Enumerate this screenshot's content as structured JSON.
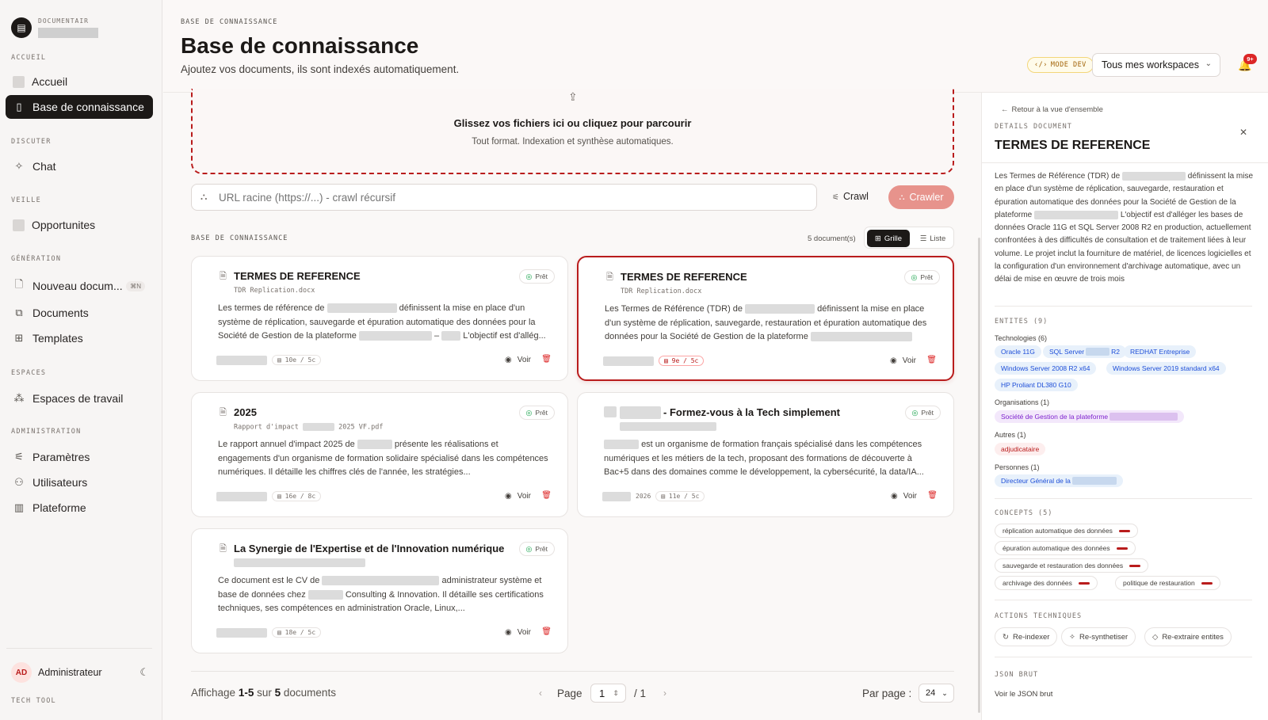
{
  "sidebar": {
    "brand_label": "DOCUMENTAIR",
    "sections": {
      "accueil": "ACCUEIL",
      "discuter": "DISCUTER",
      "veille": "VEILLE",
      "generation": "GÉNÉRATION",
      "espaces": "ESPACES",
      "administration": "ADMINISTRATION"
    },
    "items": {
      "accueil": "Accueil",
      "base": "Base de connaissance",
      "chat": "Chat",
      "opportunites": "Opportunites",
      "nouveau": "Nouveau docum...",
      "nouveau_kbd": "⌘N",
      "documents": "Documents",
      "templates": "Templates",
      "espaces_travail": "Espaces de travail",
      "parametres": "Paramètres",
      "utilisateurs": "Utilisateurs",
      "plateforme": "Plateforme"
    },
    "user": {
      "initials": "AD",
      "name": "Administrateur"
    },
    "footer": "TECH TOOL"
  },
  "header": {
    "breadcrumb": "BASE DE CONNAISSANCE",
    "title": "Base de connaissance",
    "subtitle": "Ajoutez vos documents, ils sont indexés automatiquement.",
    "mode_dev": "MODE DEV",
    "workspace": "Tous mes workspaces",
    "notif_count": "9+"
  },
  "dropzone": {
    "title": "Glissez vos fichiers ici ou cliquez pour parcourir",
    "subtitle": "Tout format. Indexation et synthèse automatiques."
  },
  "crawl": {
    "placeholder": "URL racine (https://...) - crawl récursif",
    "link_label": "Crawl",
    "button_label": "Crawler"
  },
  "list": {
    "section_label": "BASE DE CONNAISSANCE",
    "count": "5 document(s)",
    "view_grid": "Grille",
    "view_list": "Liste",
    "voir_label": "Voir",
    "status_label": "Prêt"
  },
  "cards": [
    {
      "title": "TERMES DE REFERENCE",
      "file": "TDR Replication.docx",
      "desc_a": "Les termes de référence de",
      "desc_b": "définissent la mise en place d'un système de réplication, sauvegarde et épuration automatique des données pour la Société de Gestion de la plateforme",
      "desc_c": "L'objectif est d'allég...",
      "chip": "10e / 5c",
      "year": ""
    },
    {
      "title": "TERMES DE REFERENCE",
      "file": "TDR Replication.docx",
      "desc_a": "Les Termes de Référence (TDR) de",
      "desc_b": "définissent la mise en place d'un système de réplication, sauvegarde, restauration et épuration automatique des données pour la Société de Gestion de la plateforme",
      "desc_c": "",
      "chip": "9e / 5c",
      "year": ""
    },
    {
      "title": "2025",
      "file_a": "Rapport d'impact",
      "file_b": "2025 VF.pdf",
      "desc_a": "Le rapport annuel d'impact 2025 de",
      "desc_b": "présente les réalisations et engagements d'un organisme de formation solidaire spécialisé dans les compétences numériques. Il détaille les chiffres clés de l'année, les stratégies...",
      "chip": "16e / 8c",
      "year": ""
    },
    {
      "title": "- Formez-vous à la Tech simplement",
      "desc_b": "est un organisme de formation français spécialisé dans les compétences numériques et les métiers de la tech, proposant des formations de découverte à Bac+5 dans des domaines comme le développement, la cybersécurité, la data/IA...",
      "chip": "11e / 5c",
      "year": "2026"
    },
    {
      "title": "La Synergie de l'Expertise et de l'Innovation numérique",
      "desc_a": "Ce document est le CV de",
      "desc_b": "administrateur système et base de données chez",
      "desc_c": "Consulting & Innovation. Il détaille ses certifications techniques, ses compétences en administration Oracle, Linux,...",
      "chip": "18e / 5c",
      "year": ""
    }
  ],
  "pagination": {
    "showing_prefix": "Affichage",
    "showing_range": "1-5",
    "showing_mid": "sur",
    "showing_total": "5",
    "showing_suffix": "documents",
    "page_label": "Page",
    "page_value": "1",
    "page_total": "/ 1",
    "per_page_label": "Par page :",
    "per_page_value": "24"
  },
  "panel": {
    "back": "Retour à la vue d'ensemble",
    "section": "DETAILS DOCUMENT",
    "title": "TERMES DE REFERENCE",
    "desc_a": "Les Termes de Référence (TDR) de",
    "desc_b": "définissent la mise en place d'un système de réplication, sauvegarde, restauration et épuration automatique des données pour la Société de Gestion de la plateforme",
    "desc_c": "L'objectif est d'alléger les bases de données Oracle 11G et SQL Server 2008 R2 en production, actuellement confrontées à des difficultés de consultation et de traitement liées à leur volume. Le projet inclut la fourniture de matériel, de licences logicielles et la configuration d'un environnement d'archivage automatique, avec un délai de mise en œuvre de trois mois",
    "entities_label": "ENTITES (9)",
    "tech_label": "Technologies (6)",
    "tech": [
      "Oracle 11G",
      "SQL Server",
      "R2",
      "REDHAT Entreprise",
      "Windows Server 2008 R2 x64",
      "Windows Server 2019 standard x64",
      "HP Proliant DL380 G10"
    ],
    "org_label": "Organisations (1)",
    "org": "Société de Gestion de la plateforme",
    "other_label": "Autres (1)",
    "other": "adjudicataire",
    "person_label": "Personnes (1)",
    "person": "Directeur Général de la",
    "concepts_label": "CONCEPTS (5)",
    "concepts": [
      "réplication automatique des données",
      "épuration automatique des données",
      "sauvegarde et restauration des données",
      "archivage des données",
      "politique de restauration"
    ],
    "actions_label": "ACTIONS TECHNIQUES",
    "actions": [
      "Re-indexer",
      "Re-synthetiser",
      "Re-extraire entites"
    ],
    "json_label": "JSON BRUT",
    "json_link": "Voir le JSON brut"
  }
}
